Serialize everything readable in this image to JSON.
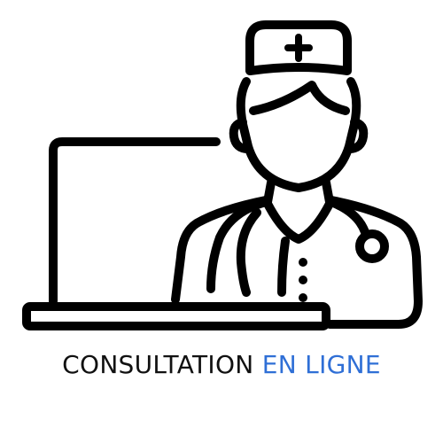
{
  "caption": {
    "part1": "CONSULTATION",
    "part2": "EN LIGNE"
  },
  "colors": {
    "line": "#000000",
    "caption_dark": "#111111",
    "caption_accent": "#2f6fd6"
  },
  "icons": {
    "illustration": "doctor-with-laptop-icon"
  }
}
